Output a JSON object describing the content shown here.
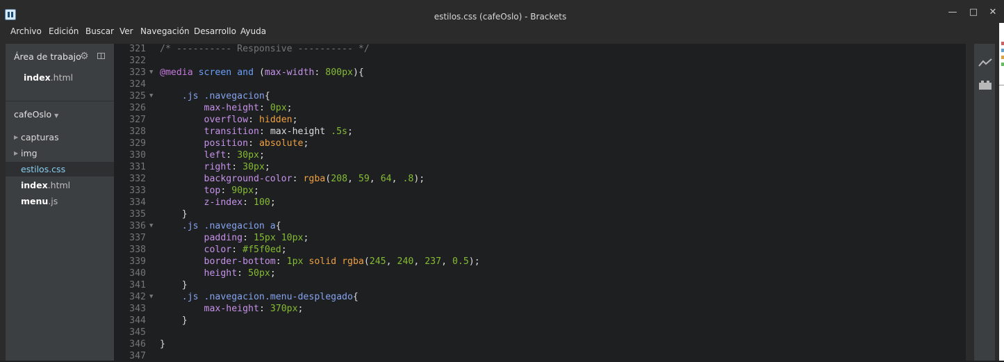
{
  "window": {
    "title": "estilos.css (cafeOslo) - Brackets"
  },
  "menu": [
    "Archivo",
    "Edición",
    "Buscar",
    "Ver",
    "Navegación",
    "Desarrollo",
    "Ayuda"
  ],
  "sidebar": {
    "working_set_title": "Área de trabajo",
    "working_files": [
      {
        "base": "index",
        "ext": ".html"
      }
    ],
    "project_name": "cafeOslo",
    "tree": [
      {
        "label": "capturas",
        "type": "folder"
      },
      {
        "label": "img",
        "type": "folder"
      },
      {
        "label": "estilos.css",
        "type": "file",
        "selected": true
      },
      {
        "base": "index",
        "ext": ".html",
        "type": "file"
      },
      {
        "base": "menu",
        "ext": ".js",
        "type": "file"
      }
    ]
  },
  "editor": {
    "lines": [
      {
        "n": "321",
        "fold": false,
        "tokens": [
          [
            "/* ---------- Responsive ---------- */",
            "c"
          ]
        ]
      },
      {
        "n": "322",
        "fold": false,
        "tokens": []
      },
      {
        "n": "323",
        "fold": true,
        "tokens": [
          [
            "@media",
            "a"
          ],
          [
            " ",
            "d"
          ],
          [
            "screen",
            "k"
          ],
          [
            " ",
            "d"
          ],
          [
            "and",
            "k"
          ],
          [
            " (",
            "d"
          ],
          [
            "max-width",
            "p"
          ],
          [
            ": ",
            "d"
          ],
          [
            "800px",
            "n"
          ],
          [
            "){",
            "d"
          ]
        ]
      },
      {
        "n": "324",
        "fold": false,
        "tokens": []
      },
      {
        "n": "325",
        "fold": true,
        "tokens": [
          [
            "    ",
            "d"
          ],
          [
            ".js .navegacion",
            "s"
          ],
          [
            "{",
            "d"
          ]
        ]
      },
      {
        "n": "326",
        "fold": false,
        "tokens": [
          [
            "        ",
            "d"
          ],
          [
            "max-height",
            "p"
          ],
          [
            ": ",
            "d"
          ],
          [
            "0px",
            "n"
          ],
          [
            ";",
            "d"
          ]
        ]
      },
      {
        "n": "327",
        "fold": false,
        "tokens": [
          [
            "        ",
            "d"
          ],
          [
            "overflow",
            "p"
          ],
          [
            ": ",
            "d"
          ],
          [
            "hidden",
            "v"
          ],
          [
            ";",
            "d"
          ]
        ]
      },
      {
        "n": "328",
        "fold": false,
        "tokens": [
          [
            "        ",
            "d"
          ],
          [
            "transition",
            "p"
          ],
          [
            ": max-height ",
            "d"
          ],
          [
            ".5s",
            "n"
          ],
          [
            ";",
            "d"
          ]
        ]
      },
      {
        "n": "329",
        "fold": false,
        "tokens": [
          [
            "        ",
            "d"
          ],
          [
            "position",
            "p"
          ],
          [
            ": ",
            "d"
          ],
          [
            "absolute",
            "v"
          ],
          [
            ";",
            "d"
          ]
        ]
      },
      {
        "n": "330",
        "fold": false,
        "tokens": [
          [
            "        ",
            "d"
          ],
          [
            "left",
            "p"
          ],
          [
            ": ",
            "d"
          ],
          [
            "30px",
            "n"
          ],
          [
            ";",
            "d"
          ]
        ]
      },
      {
        "n": "331",
        "fold": false,
        "tokens": [
          [
            "        ",
            "d"
          ],
          [
            "right",
            "p"
          ],
          [
            ": ",
            "d"
          ],
          [
            "30px",
            "n"
          ],
          [
            ";",
            "d"
          ]
        ]
      },
      {
        "n": "332",
        "fold": false,
        "tokens": [
          [
            "        ",
            "d"
          ],
          [
            "background-color",
            "p"
          ],
          [
            ": ",
            "d"
          ],
          [
            "rgba",
            "f"
          ],
          [
            "(",
            "d"
          ],
          [
            "208",
            "n"
          ],
          [
            ", ",
            "d"
          ],
          [
            "59",
            "n"
          ],
          [
            ", ",
            "d"
          ],
          [
            "64",
            "n"
          ],
          [
            ", ",
            "d"
          ],
          [
            ".8",
            "n"
          ],
          [
            ");",
            "d"
          ]
        ]
      },
      {
        "n": "333",
        "fold": false,
        "tokens": [
          [
            "        ",
            "d"
          ],
          [
            "top",
            "p"
          ],
          [
            ": ",
            "d"
          ],
          [
            "90px",
            "n"
          ],
          [
            ";",
            "d"
          ]
        ]
      },
      {
        "n": "334",
        "fold": false,
        "tokens": [
          [
            "        ",
            "d"
          ],
          [
            "z-index",
            "p"
          ],
          [
            ": ",
            "d"
          ],
          [
            "100",
            "n"
          ],
          [
            ";",
            "d"
          ]
        ]
      },
      {
        "n": "335",
        "fold": false,
        "tokens": [
          [
            "    }",
            "d"
          ]
        ]
      },
      {
        "n": "336",
        "fold": true,
        "tokens": [
          [
            "    ",
            "d"
          ],
          [
            ".js .navegacion a",
            "s"
          ],
          [
            "{",
            "d"
          ]
        ]
      },
      {
        "n": "337",
        "fold": false,
        "tokens": [
          [
            "        ",
            "d"
          ],
          [
            "padding",
            "p"
          ],
          [
            ": ",
            "d"
          ],
          [
            "15px 10px",
            "n"
          ],
          [
            ";",
            "d"
          ]
        ]
      },
      {
        "n": "338",
        "fold": false,
        "tokens": [
          [
            "        ",
            "d"
          ],
          [
            "color",
            "p"
          ],
          [
            ": ",
            "d"
          ],
          [
            "#f5f0ed",
            "h"
          ],
          [
            ";",
            "d"
          ]
        ]
      },
      {
        "n": "339",
        "fold": false,
        "tokens": [
          [
            "        ",
            "d"
          ],
          [
            "border-bottom",
            "p"
          ],
          [
            ": ",
            "d"
          ],
          [
            "1px",
            "n"
          ],
          [
            " ",
            "d"
          ],
          [
            "solid",
            "v"
          ],
          [
            " ",
            "d"
          ],
          [
            "rgba",
            "f"
          ],
          [
            "(",
            "d"
          ],
          [
            "245",
            "n"
          ],
          [
            ", ",
            "d"
          ],
          [
            "240",
            "n"
          ],
          [
            ", ",
            "d"
          ],
          [
            "237",
            "n"
          ],
          [
            ", ",
            "d"
          ],
          [
            "0.5",
            "n"
          ],
          [
            ");",
            "d"
          ]
        ]
      },
      {
        "n": "340",
        "fold": false,
        "tokens": [
          [
            "        ",
            "d"
          ],
          [
            "height",
            "p"
          ],
          [
            ": ",
            "d"
          ],
          [
            "50px",
            "n"
          ],
          [
            ";",
            "d"
          ]
        ]
      },
      {
        "n": "341",
        "fold": false,
        "tokens": [
          [
            "    }",
            "d"
          ]
        ]
      },
      {
        "n": "342",
        "fold": true,
        "tokens": [
          [
            "    ",
            "d"
          ],
          [
            ".js .navegacion.menu-desplegado",
            "s"
          ],
          [
            "{",
            "d"
          ]
        ]
      },
      {
        "n": "343",
        "fold": false,
        "tokens": [
          [
            "        ",
            "d"
          ],
          [
            "max-height",
            "p"
          ],
          [
            ": ",
            "d"
          ],
          [
            "370px",
            "n"
          ],
          [
            ";",
            "d"
          ]
        ]
      },
      {
        "n": "344",
        "fold": false,
        "tokens": [
          [
            "    }",
            "d"
          ]
        ]
      },
      {
        "n": "345",
        "fold": false,
        "tokens": []
      },
      {
        "n": "346",
        "fold": false,
        "tokens": [
          [
            "}",
            "d"
          ]
        ]
      },
      {
        "n": "347",
        "fold": false,
        "tokens": []
      }
    ]
  },
  "icons": {
    "app": "brackets-logo-icon",
    "gear": "gear-icon",
    "split": "split-view-icon",
    "live": "live-preview-icon",
    "extensions": "extension-manager-icon"
  }
}
